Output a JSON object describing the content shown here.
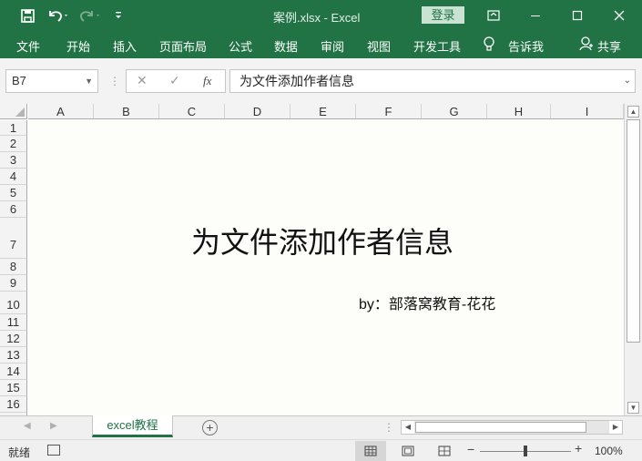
{
  "window": {
    "title": "案例.xlsx  -  Excel",
    "login_label": "登录"
  },
  "ribbon": {
    "tabs": [
      "文件",
      "开始",
      "插入",
      "页面布局",
      "公式",
      "数据",
      "审阅",
      "视图",
      "开发工具"
    ],
    "tell_me": "告诉我",
    "share": "共享"
  },
  "formula_bar": {
    "name_box": "B7",
    "fx_label": "fx",
    "content": "为文件添加作者信息"
  },
  "grid": {
    "columns": [
      "A",
      "B",
      "C",
      "D",
      "E",
      "F",
      "G",
      "H",
      "I"
    ],
    "rows": [
      "1",
      "2",
      "3",
      "4",
      "5",
      "6",
      "7",
      "8",
      "9",
      "10",
      "11",
      "12",
      "13",
      "14",
      "15",
      "16"
    ],
    "cell_title": "为文件添加作者信息",
    "cell_byline": "by：部落窝教育-花花"
  },
  "sheets": {
    "tabs": [
      "excel教程"
    ],
    "add_label": "+"
  },
  "status": {
    "mode": "就绪",
    "zoom": "100%",
    "zoom_level": 1.0
  },
  "colors": {
    "brand": "#217346",
    "sheet_bg": "#fdfdf9"
  }
}
